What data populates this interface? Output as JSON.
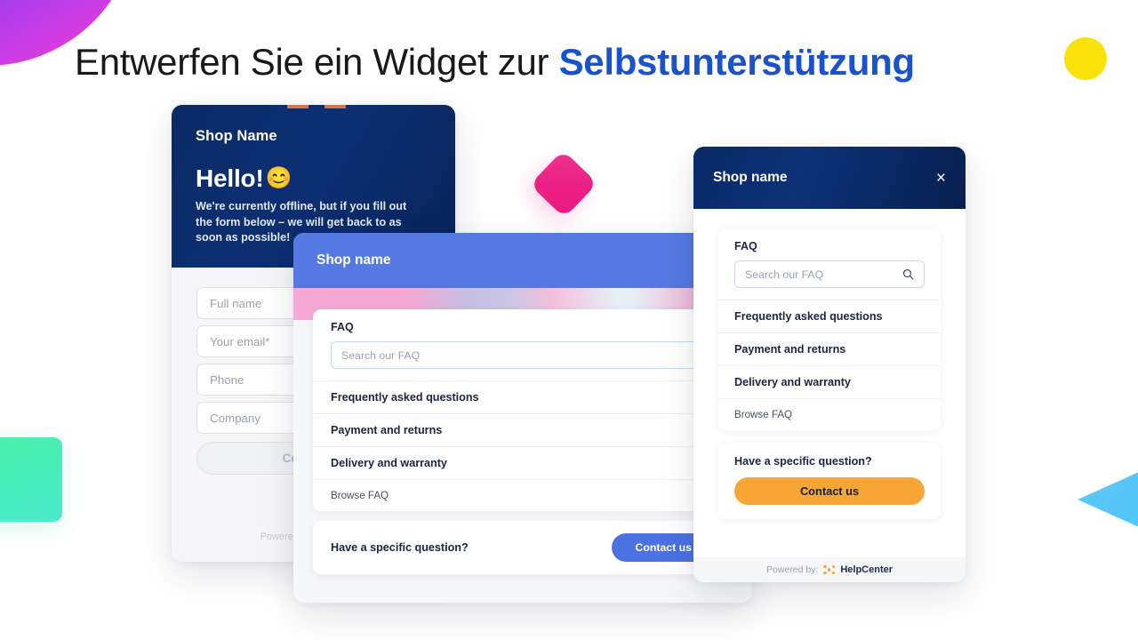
{
  "headline": {
    "plain": "Entwerfen Sie ein Widget zur ",
    "accent": "Selbstunterstützung"
  },
  "shapes": {
    "petal": "purple-petal-shape",
    "yellow_dot": "#fbe10a",
    "pink_diamond": "#ea1f84",
    "green_square": "#49eeb6",
    "blue_triangle": "#55c6f8"
  },
  "offline_card": {
    "shop_name": "Shop Name",
    "greeting": "Hello!",
    "greeting_emoji": "😊",
    "subtitle": "We're currently offline, but if you fill out the form below – we will get back to as soon as possible!",
    "fields": [
      {
        "placeholder": "Full name"
      },
      {
        "placeholder": "Your email*"
      },
      {
        "placeholder": "Phone"
      },
      {
        "placeholder": "Company"
      }
    ],
    "submit_label": "Contact us",
    "powered_text": "Powered by: HelpCenter"
  },
  "faq_wide_card": {
    "shop_name": "Shop name",
    "faq_label": "FAQ",
    "search_placeholder": "Search our FAQ",
    "rows": [
      "Frequently asked questions",
      "Payment and returns",
      "Delivery and warranty"
    ],
    "browse_label": "Browse FAQ",
    "cta_question": "Have a specific question?",
    "cta_button": "Contact us"
  },
  "faq_narrow_card": {
    "shop_name": "Shop name",
    "close_icon": "×",
    "faq_label": "FAQ",
    "search_placeholder": "Search our FAQ",
    "rows": [
      "Frequently asked questions",
      "Payment and returns",
      "Delivery and warranty"
    ],
    "browse_label": "Browse FAQ",
    "cta_question": "Have a specific question?",
    "cta_button": "Contact us",
    "footer_powered": "Powered by:",
    "footer_brand": "HelpCenter"
  }
}
